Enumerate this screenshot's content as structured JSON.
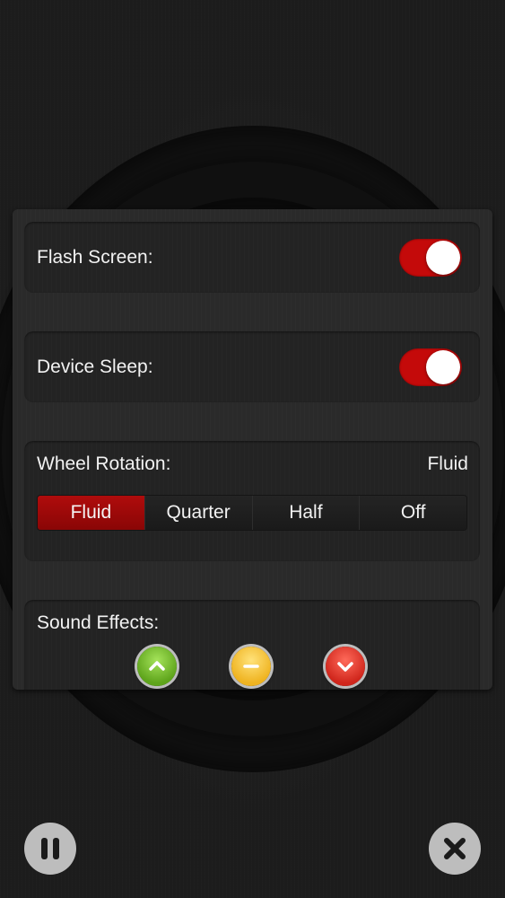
{
  "settings": {
    "flash_screen": {
      "label": "Flash Screen:",
      "enabled": true
    },
    "device_sleep": {
      "label": "Device Sleep:",
      "enabled": true
    },
    "wheel_rotation": {
      "label": "Wheel Rotation:",
      "current_value": "Fluid",
      "options": [
        "Fluid",
        "Quarter",
        "Half",
        "Off"
      ],
      "selected_index": 0
    },
    "sound_effects": {
      "label": "Sound Effects:",
      "buttons": [
        {
          "icon": "chevron-up-icon",
          "color": "#7cc52e"
        },
        {
          "icon": "minus-icon",
          "color": "#f5c842"
        },
        {
          "icon": "chevron-down-icon",
          "color": "#e33a2c"
        }
      ]
    }
  },
  "controls": {
    "pause_icon": "pause-icon",
    "close_icon": "close-icon"
  },
  "colors": {
    "toggle_on": "#c40a0a",
    "segment_selected": "#a00a0a",
    "control_button": "#bdbdbd"
  }
}
